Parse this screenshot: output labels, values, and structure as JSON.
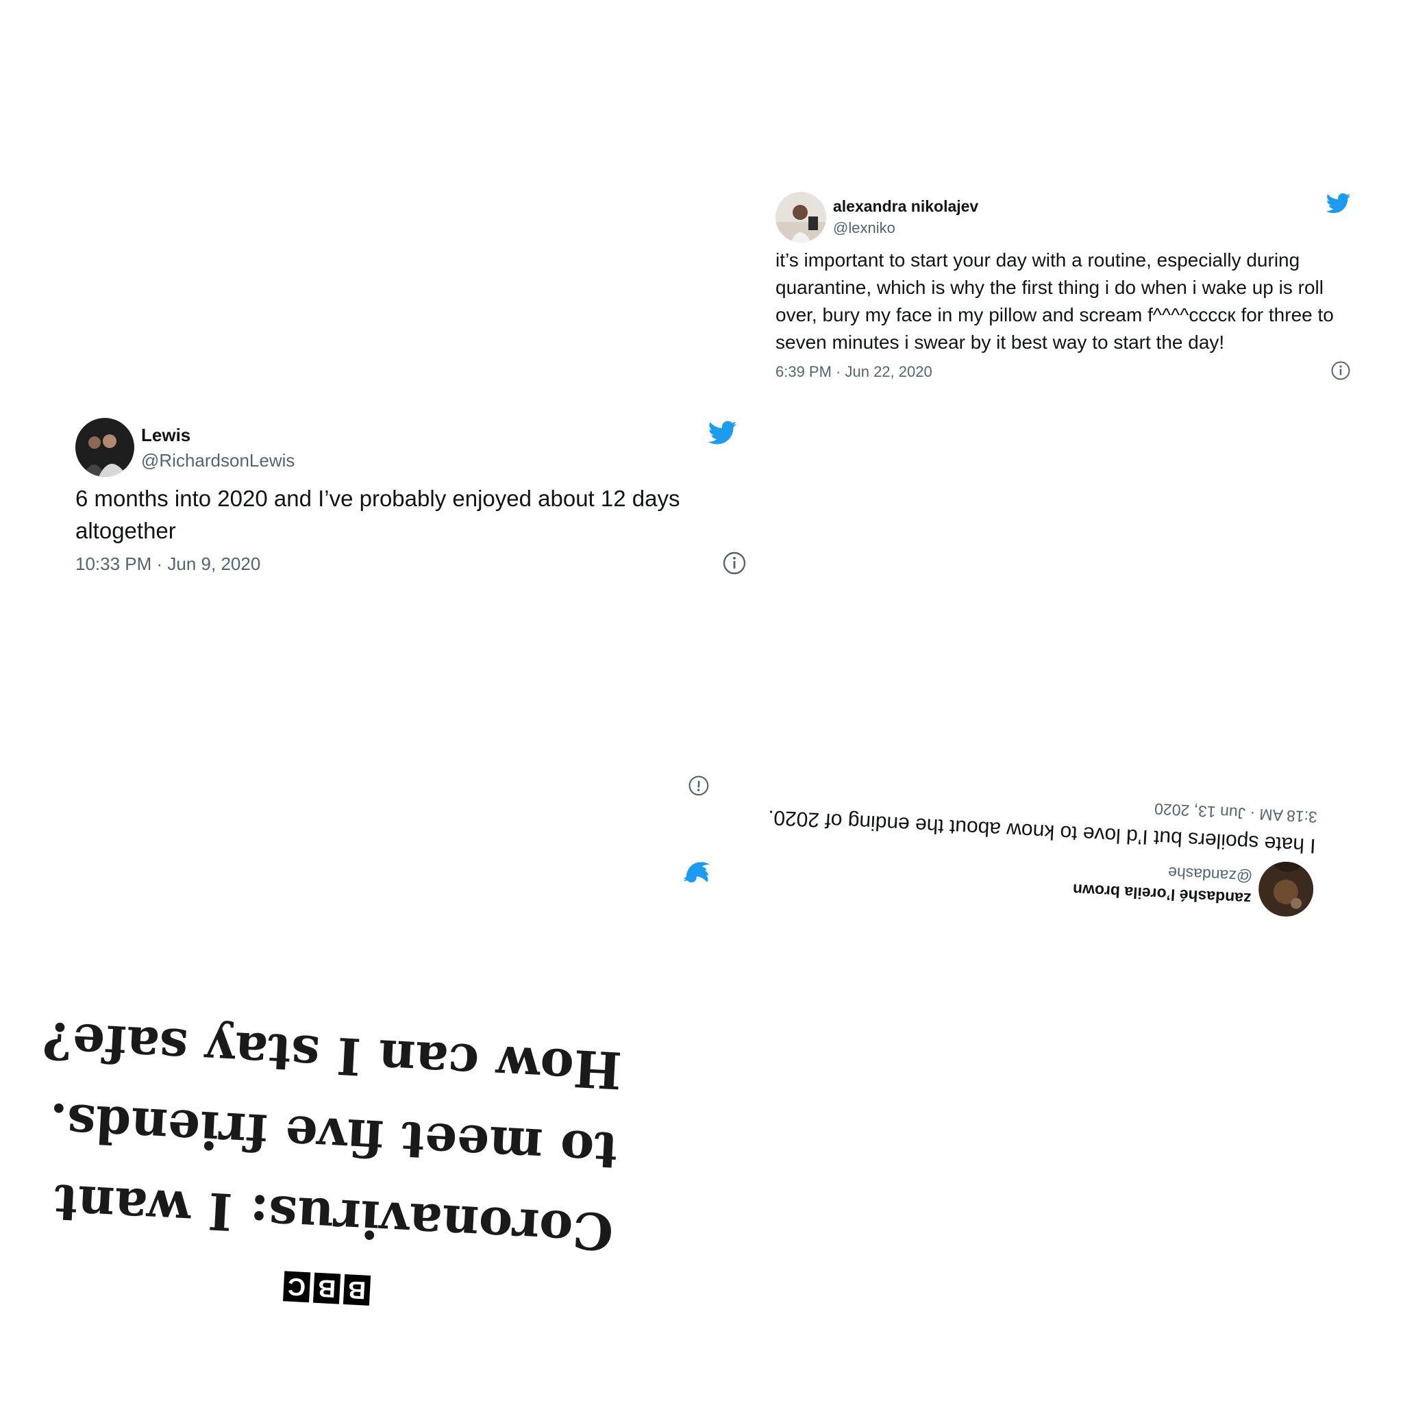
{
  "tweets": [
    {
      "display_name": "alexandra nikolajev",
      "handle": "@lexniko",
      "text": "it’s important to start your day with a routine, especially during quarantine, which is why the first thing i do when i wake up is roll over, bury my face in my pillow and scream f^^^^ccccк for three to seven minutes i swear by it best way to start the day!",
      "timestamp": "6:39 PM · Jun 22, 2020",
      "orientation": "upright"
    },
    {
      "display_name": "Lewis",
      "handle": "@RichardsonLewis",
      "text": "6 months into 2020 and I’ve probably enjoyed about 12 days altogether",
      "timestamp": "10:33 PM · Jun 9, 2020",
      "orientation": "upright"
    },
    {
      "display_name": "zandashé l’oreila brown",
      "handle": "@zandashe",
      "text": "I hate spoilers but I’d love to know about the ending of 2020.",
      "timestamp": "3:18 AM · Jun 13, 2020",
      "orientation": "upside-down"
    }
  ],
  "bbc": {
    "logo_letters": [
      "B",
      "B",
      "C"
    ],
    "headline": "Coronavirus: I want to meet five friends. How can I stay safe?",
    "orientation": "upside-down"
  },
  "icons": {
    "bird": "twitter-bird-icon",
    "info": "info-icon"
  },
  "colors": {
    "twitter_blue": "#1d9bf0",
    "text_primary": "#0f1419",
    "text_secondary": "#536471"
  }
}
